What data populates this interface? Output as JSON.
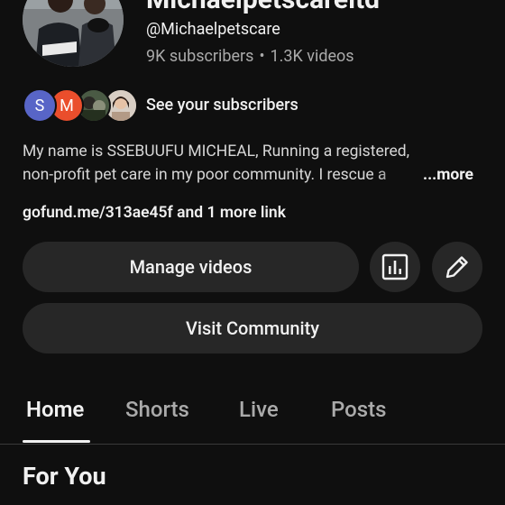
{
  "channel": {
    "name": "Michaelpetscareltd",
    "handle": "@Michaelpetscare",
    "subscribers": "9K subscribers",
    "separator": "•",
    "videos": "1.3K videos"
  },
  "subscribers_preview": {
    "avatars": [
      {
        "letter": "S",
        "color": "#5865c7"
      },
      {
        "letter": "M",
        "color": "#ea4e2c"
      }
    ],
    "label": "See your subscribers"
  },
  "description": {
    "line1": "My name is SSEBUUFU MICHEAL, Running a registered,",
    "line2": "non-profit pet care in my poor community. I rescue a",
    "more_label": "...more"
  },
  "links": {
    "primary": "gofund.me/313ae45f",
    "extra": " and 1 more link"
  },
  "actions": {
    "manage_label": "Manage videos",
    "community_label": "Visit Community",
    "analytics_icon": "analytics-icon",
    "edit_icon": "pencil-icon"
  },
  "tabs": [
    {
      "label": "Home",
      "active": true
    },
    {
      "label": "Shorts",
      "active": false
    },
    {
      "label": "Live",
      "active": false
    },
    {
      "label": "Posts",
      "active": false
    }
  ],
  "section": {
    "title": "For You"
  },
  "colors": {
    "background": "#0f0f0f",
    "button": "#272727",
    "text_primary": "#f1f1f1",
    "text_secondary": "#aaaaaa"
  }
}
